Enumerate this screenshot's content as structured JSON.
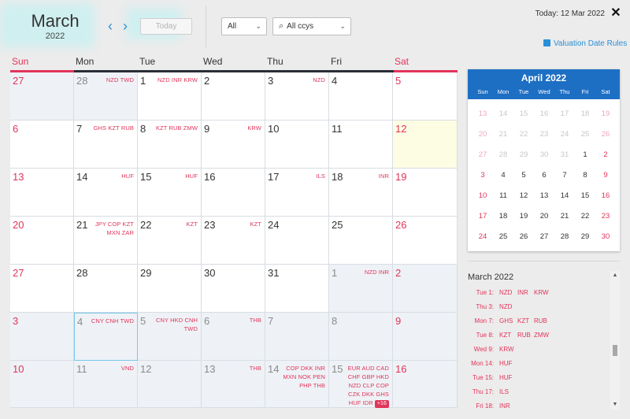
{
  "header": {
    "month": "March",
    "year": "2022",
    "today_button": "Today",
    "filter_select": "All",
    "ccy_select": "All ccys",
    "today_label": "Today: 12 Mar 2022",
    "valuation_rules": "Valuation Date Rules"
  },
  "weekdays": [
    "Sun",
    "Mon",
    "Tue",
    "Wed",
    "Thu",
    "Fri",
    "Sat"
  ],
  "calendar": {
    "weeks": [
      [
        {
          "day": "27",
          "shade": true,
          "ccys": ""
        },
        {
          "day": "28",
          "shade": true,
          "ccys": "NZD TWD"
        },
        {
          "day": "1",
          "ccys": "NZD INR  KRW"
        },
        {
          "day": "2",
          "ccys": ""
        },
        {
          "day": "3",
          "ccys": "NZD"
        },
        {
          "day": "4",
          "ccys": ""
        },
        {
          "day": "5",
          "ccys": ""
        }
      ],
      [
        {
          "day": "6",
          "ccys": ""
        },
        {
          "day": "7",
          "ccys": "GHS KZT RUB"
        },
        {
          "day": "8",
          "ccys": "KZT RUB ZMW"
        },
        {
          "day": "9",
          "ccys": "KRW"
        },
        {
          "day": "10",
          "ccys": ""
        },
        {
          "day": "11",
          "ccys": ""
        },
        {
          "day": "12",
          "today": true,
          "ccys": ""
        }
      ],
      [
        {
          "day": "13",
          "ccys": ""
        },
        {
          "day": "14",
          "ccys": "HUF"
        },
        {
          "day": "15",
          "ccys": "HUF"
        },
        {
          "day": "16",
          "ccys": ""
        },
        {
          "day": "17",
          "ccys": "ILS"
        },
        {
          "day": "18",
          "ccys": "INR"
        },
        {
          "day": "19",
          "ccys": ""
        }
      ],
      [
        {
          "day": "20",
          "ccys": ""
        },
        {
          "day": "21",
          "ccys": "JPY  COP KZT MXN ZAR"
        },
        {
          "day": "22",
          "ccys": "KZT"
        },
        {
          "day": "23",
          "ccys": "KZT"
        },
        {
          "day": "24",
          "ccys": ""
        },
        {
          "day": "25",
          "ccys": ""
        },
        {
          "day": "26",
          "ccys": ""
        }
      ],
      [
        {
          "day": "27",
          "ccys": ""
        },
        {
          "day": "28",
          "ccys": ""
        },
        {
          "day": "29",
          "ccys": ""
        },
        {
          "day": "30",
          "ccys": ""
        },
        {
          "day": "31",
          "ccys": ""
        },
        {
          "day": "1",
          "shade": true,
          "ccys": "NZD INR"
        },
        {
          "day": "2",
          "shade": true,
          "ccys": ""
        }
      ],
      [
        {
          "day": "3",
          "shade": true,
          "ccys": ""
        },
        {
          "day": "4",
          "shade": true,
          "sel": true,
          "ccys": "CNY CNH TWD"
        },
        {
          "day": "5",
          "shade": true,
          "ccys": "CNY HKD CNH TWD"
        },
        {
          "day": "6",
          "shade": true,
          "ccys": "THB"
        },
        {
          "day": "7",
          "shade": true,
          "ccys": ""
        },
        {
          "day": "8",
          "shade": true,
          "ccys": ""
        },
        {
          "day": "9",
          "shade": true,
          "ccys": ""
        }
      ],
      [
        {
          "day": "10",
          "shade": true,
          "ccys": ""
        },
        {
          "day": "11",
          "shade": true,
          "ccys": "VND"
        },
        {
          "day": "12",
          "shade": true,
          "ccys": ""
        },
        {
          "day": "13",
          "shade": true,
          "ccys": "THB"
        },
        {
          "day": "14",
          "shade": true,
          "ccys": "COP DKK INR MXN NOK PEN PHP THB"
        },
        {
          "day": "15",
          "shade": true,
          "ccys": "EUR AUD CAD CHF GBP HKD NZD CLP COP CZK DKK GHS HUF IDR",
          "badge": "+16"
        },
        {
          "day": "16",
          "shade": true,
          "ccys": ""
        }
      ]
    ]
  },
  "mini": {
    "title": "April 2022",
    "daynames": [
      "Sun",
      "Mon",
      "Tue",
      "Wed",
      "Thu",
      "Fri",
      "Sat"
    ],
    "weeks": [
      [
        "13",
        "14",
        "15",
        "16",
        "17",
        "18",
        "19"
      ],
      [
        "20",
        "21",
        "22",
        "23",
        "24",
        "25",
        "26"
      ],
      [
        "27",
        "28",
        "29",
        "30",
        "31",
        "1",
        "2"
      ],
      [
        "3",
        "4",
        "5",
        "6",
        "7",
        "8",
        "9"
      ],
      [
        "10",
        "11",
        "12",
        "13",
        "14",
        "15",
        "16"
      ],
      [
        "17",
        "18",
        "19",
        "20",
        "21",
        "22",
        "23"
      ],
      [
        "24",
        "25",
        "26",
        "27",
        "28",
        "29",
        "30"
      ]
    ],
    "dim_rows": 3
  },
  "list": {
    "title": "March 2022",
    "rows": [
      {
        "label": "Tue 1:",
        "ccys": [
          "NZD",
          "INR",
          "KRW"
        ]
      },
      {
        "label": "Thu 3:",
        "ccys": [
          "NZD"
        ]
      },
      {
        "label": "Mon 7:",
        "ccys": [
          "GHS",
          "KZT",
          "RUB"
        ]
      },
      {
        "label": "Tue 8:",
        "ccys": [
          "KZT",
          "RUB",
          "ZMW"
        ]
      },
      {
        "label": "Wed 9:",
        "ccys": [
          "KRW"
        ]
      },
      {
        "label": "Mon 14:",
        "ccys": [
          "HUF"
        ]
      },
      {
        "label": "Tue 15:",
        "ccys": [
          "HUF"
        ]
      },
      {
        "label": "Thu 17:",
        "ccys": [
          "ILS"
        ]
      },
      {
        "label": "Fri 18:",
        "ccys": [
          "INR"
        ]
      }
    ]
  },
  "colors": {
    "weekend": "#e2345a",
    "accent": "#1d6fc4",
    "link": "#2a8fd6",
    "today_bg": "#fdfde4",
    "shade_bg": "#eef2f6"
  }
}
